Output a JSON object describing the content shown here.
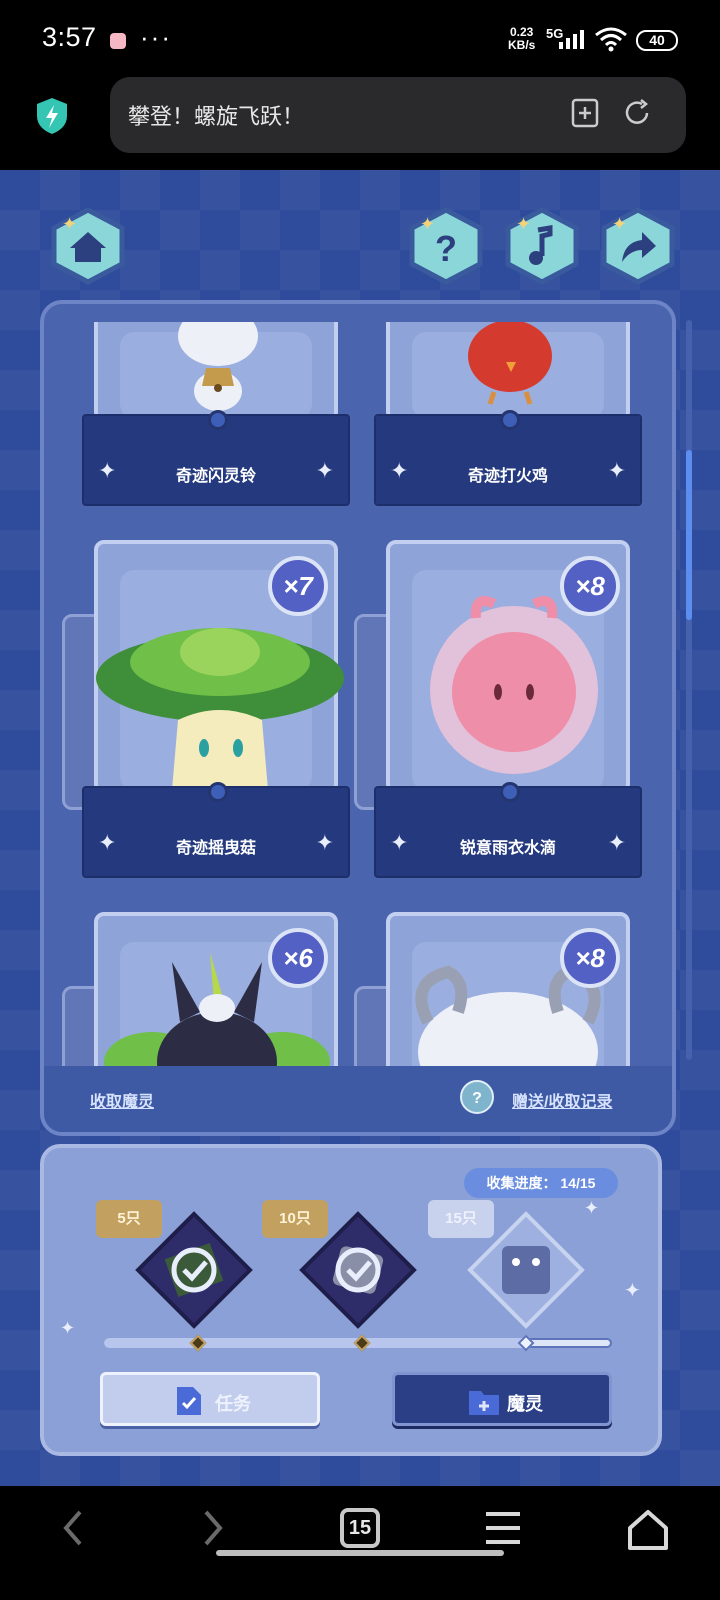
{
  "status_bar": {
    "time": "3:57",
    "network_speed_value": "0.23",
    "network_speed_unit": "KB/s",
    "network_type": "5G",
    "battery": "40"
  },
  "browser": {
    "page_title": "攀登！螺旋飞跃！",
    "icons": [
      "shield-icon",
      "add-bookmark-icon",
      "refresh-icon"
    ]
  },
  "game": {
    "top_buttons": [
      "home-icon",
      "help-icon",
      "music-icon",
      "share-icon"
    ],
    "collection": {
      "cards": [
        {
          "name": "奇迹闪灵铃",
          "count": ""
        },
        {
          "name": "奇迹打火鸡",
          "count": ""
        },
        {
          "name": "奇迹摇曳菇",
          "count": "×7"
        },
        {
          "name": "锐意雨衣水滴",
          "count": "×8"
        },
        {
          "name": "",
          "count": "×6"
        },
        {
          "name": "",
          "count": "×8"
        }
      ],
      "footer": {
        "receive_link": "收取魔灵",
        "help": "?",
        "records_link": "赠送/收取记录"
      }
    },
    "rewards": {
      "progress_label": "收集进度：",
      "progress_value": "14/15",
      "progress_fraction": 0.933,
      "tiers": [
        {
          "label": "5只",
          "claimed": true
        },
        {
          "label": "10只",
          "claimed": true
        },
        {
          "label": "15只",
          "claimed": false
        }
      ],
      "buttons": {
        "task": "任务",
        "spirit": "魔灵"
      }
    }
  },
  "nav_bar": {
    "tab_count": "15",
    "icons": [
      "back-icon",
      "forward-icon",
      "tabs-icon",
      "menu-icon",
      "home-icon"
    ]
  },
  "colors": {
    "game_background": "#2f4b9b",
    "panel": "#4a64ad",
    "card_label": "#253a7e",
    "badge": "#5360c4",
    "accent_blue": "#5c8ef0"
  }
}
